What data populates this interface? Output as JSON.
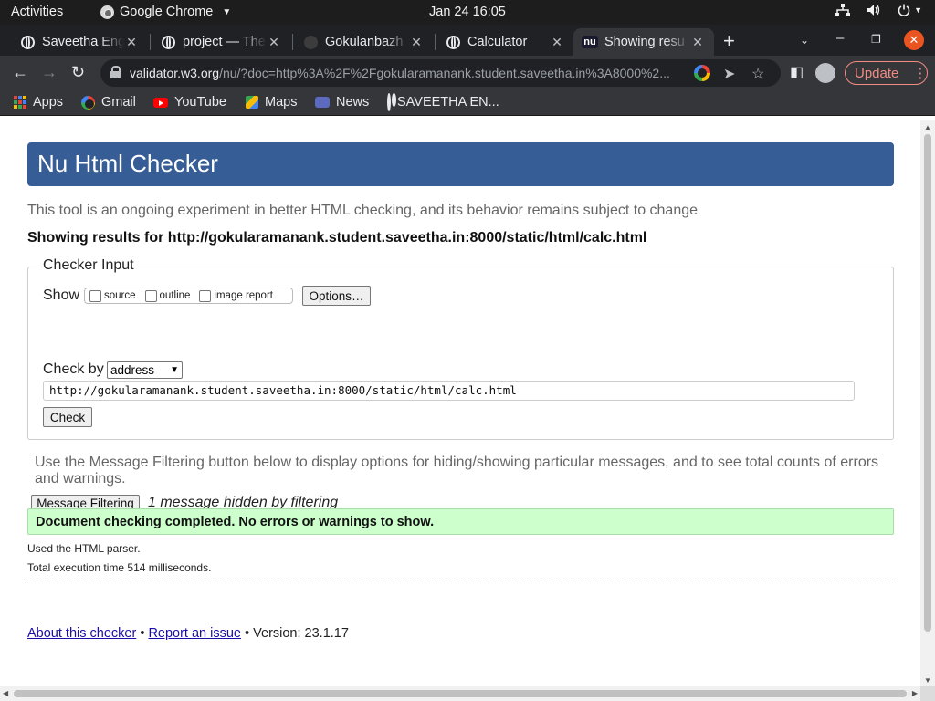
{
  "system": {
    "activities": "Activities",
    "app_name": "Google Chrome",
    "clock": "Jan 24  16:05"
  },
  "browser": {
    "tabs": [
      {
        "title": "Saveetha Eng",
        "icon": "globe-icon"
      },
      {
        "title": "project — The",
        "icon": "globe-icon"
      },
      {
        "title": "Gokulanbazh",
        "icon": "github-icon"
      },
      {
        "title": "Calculator",
        "icon": "globe-icon"
      },
      {
        "title": "Showing resu",
        "icon": "nu-icon",
        "active": true
      }
    ],
    "url_host": "validator.w3.org",
    "url_rest": "/nu/?doc=http%3A%2F%2Fgokularamanank.student.saveetha.in%3A8000%2...",
    "update_label": "Update",
    "bookmarks": [
      "Apps",
      "Gmail",
      "YouTube",
      "Maps",
      "News",
      "SAVEETHA EN..."
    ]
  },
  "page": {
    "header_title": "Nu Html Checker",
    "tagline": "This tool is an ongoing experiment in better HTML checking, and its behavior remains subject to change",
    "showing_results": "Showing results for http://gokularamanank.student.saveetha.in:8000/static/html/calc.html",
    "checker_input_legend": "Checker Input",
    "show_label": "Show",
    "show_options": [
      "source",
      "outline",
      "image report"
    ],
    "options_button": "Options…",
    "check_by_label": "Check by",
    "check_by_value": "address",
    "url_value": "http://gokularamanank.student.saveetha.in:8000/static/html/calc.html",
    "check_button": "Check",
    "filter_note": "Use the Message Filtering button below to display options for hiding/showing particular messages, and to see total counts of errors and warnings.",
    "message_filtering_button": "Message Filtering",
    "hidden_note": "1 message hidden by filtering",
    "success_message": "Document checking completed. No errors or warnings to show.",
    "parser_note": "Used the HTML parser.",
    "execution_note": "Total execution time 514 milliseconds.",
    "footer": {
      "about_link": "About this checker",
      "bullet": "•",
      "report_link": "Report an issue",
      "version": "• Version: 23.1.17"
    }
  },
  "colors": {
    "header_bg": "#365d95",
    "success_bg": "#ccffcc",
    "chrome_dark": "#202124",
    "update_accent": "#f28b82"
  }
}
